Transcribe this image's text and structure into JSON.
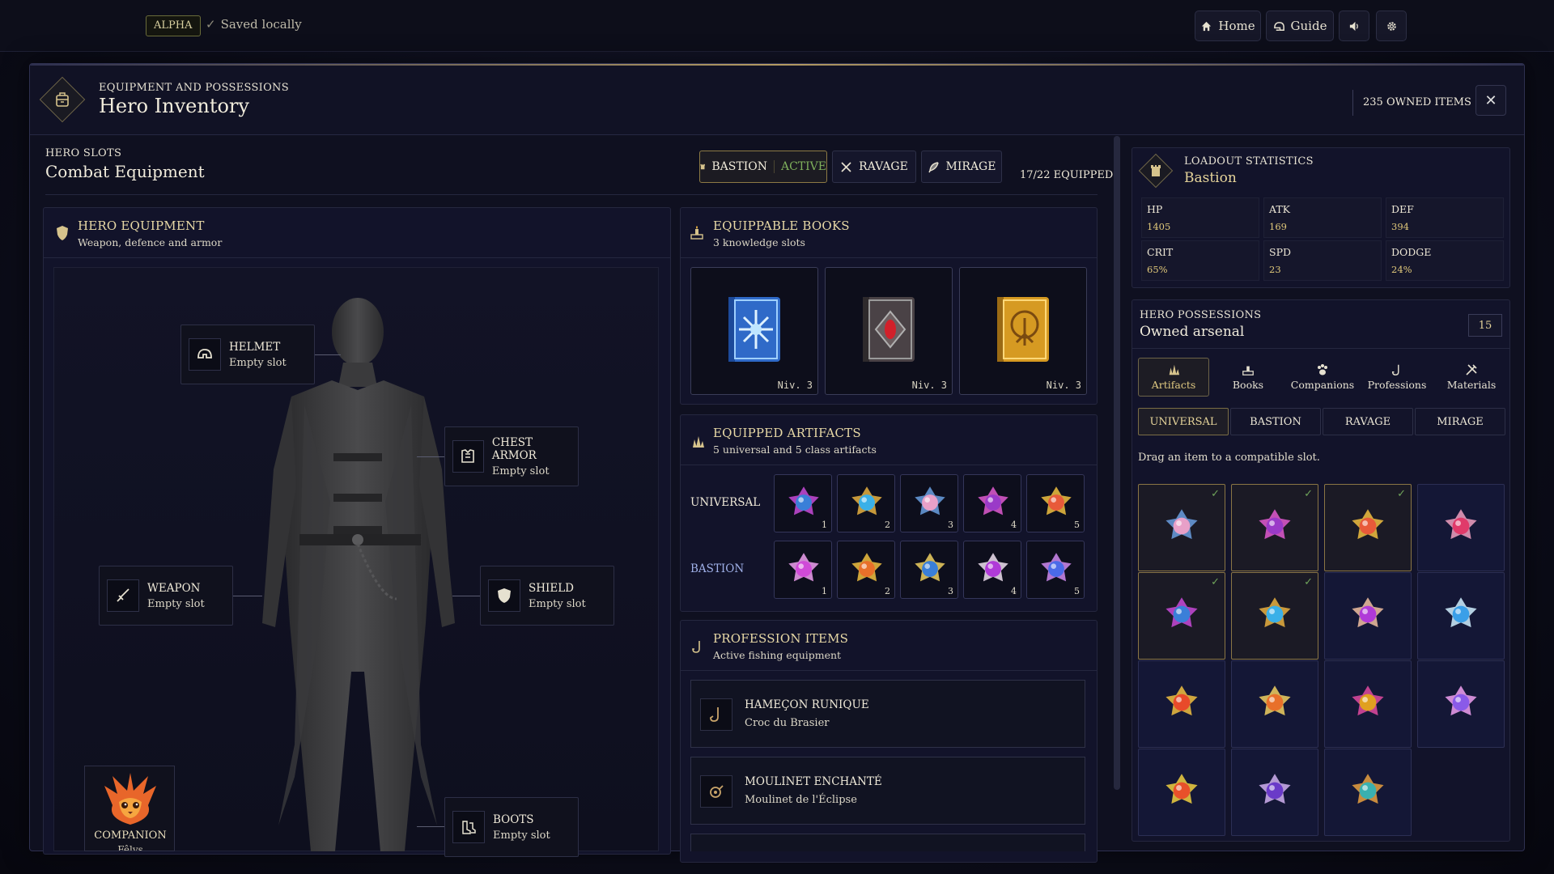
{
  "topbar": {
    "badge": "ALPHA",
    "save_status": "Saved locally",
    "home_label": "Home",
    "guide_label": "Guide"
  },
  "modal": {
    "kicker": "EQUIPMENT AND POSSESSIONS",
    "title": "Hero Inventory",
    "owned_count": "235 OWNED ITEMS"
  },
  "slots_section": {
    "kicker": "HERO SLOTS",
    "title": "Combat Equipment",
    "tabs": [
      {
        "label": "BASTION",
        "status": "ACTIVE"
      },
      {
        "label": "RAVAGE"
      },
      {
        "label": "MIRAGE"
      }
    ],
    "equipped_count": "17/22 EQUIPPED"
  },
  "hero_equipment": {
    "title": "HERO EQUIPMENT",
    "subtitle": "Weapon, defence and armor",
    "slots": {
      "helmet": {
        "name": "HELMET",
        "status": "Empty slot"
      },
      "chest": {
        "name": "CHEST ARMOR",
        "status": "Empty slot"
      },
      "weapon": {
        "name": "WEAPON",
        "status": "Empty slot"
      },
      "shield": {
        "name": "SHIELD",
        "status": "Empty slot"
      },
      "boots": {
        "name": "BOOTS",
        "status": "Empty slot"
      }
    },
    "companion": {
      "label": "COMPANION",
      "name": "Fêlys"
    }
  },
  "books": {
    "title": "EQUIPPABLE BOOKS",
    "subtitle": "3 knowledge slots",
    "items": [
      {
        "level": "Niv. 3",
        "icon": "ice-snowflake-book-icon",
        "color": "#4a8fd8"
      },
      {
        "level": "Niv. 3",
        "icon": "ruby-eye-book-icon",
        "color": "#6b5a52"
      },
      {
        "level": "Niv. 3",
        "icon": "golden-tree-book-icon",
        "color": "#d59a24"
      }
    ]
  },
  "artifacts": {
    "title": "EQUIPPED ARTIFACTS",
    "subtitle": "5 universal and 5 class artifacts",
    "rows": [
      {
        "label": "UNIVERSAL",
        "label_color": "#f0ead9",
        "items": [
          {
            "num": "1",
            "colors": [
              "#3a7fd8",
              "#c84ad8"
            ]
          },
          {
            "num": "2",
            "colors": [
              "#3ab0e8",
              "#e8b040"
            ]
          },
          {
            "num": "3",
            "colors": [
              "#e8a0c8",
              "#6a9fe0"
            ]
          },
          {
            "num": "4",
            "colors": [
              "#9a3ac8",
              "#e05ad0"
            ]
          },
          {
            "num": "5",
            "colors": [
              "#e85a3a",
              "#f0c040"
            ]
          }
        ]
      },
      {
        "label": "BASTION",
        "label_color": "#9fb0e8",
        "items": [
          {
            "num": "1",
            "colors": [
              "#d04ad8",
              "#f0a0f0"
            ]
          },
          {
            "num": "2",
            "colors": [
              "#e8702a",
              "#f0c040"
            ]
          },
          {
            "num": "3",
            "colors": [
              "#3a7fd8",
              "#f0d060"
            ]
          },
          {
            "num": "4",
            "colors": [
              "#b03ad8",
              "#f0e0f0"
            ]
          },
          {
            "num": "5",
            "colors": [
              "#4a6ae8",
              "#d08af0"
            ]
          }
        ]
      }
    ]
  },
  "profession": {
    "title": "PROFESSION ITEMS",
    "subtitle": "Active fishing equipment",
    "items": [
      {
        "name": "HAMEÇON RUNIQUE",
        "sub": "Croc du Brasier",
        "icon": "fishing-hook-icon"
      },
      {
        "name": "MOULINET ENCHANTÉ",
        "sub": "Moulinet de l'Éclipse",
        "icon": "fishing-reel-icon"
      }
    ]
  },
  "loadout": {
    "kicker": "LOADOUT STATISTICS",
    "title": "Bastion",
    "stats": [
      {
        "key": "HP",
        "value": "1405"
      },
      {
        "key": "ATK",
        "value": "169"
      },
      {
        "key": "DEF",
        "value": "394"
      },
      {
        "key": "CRIT",
        "value": "65%"
      },
      {
        "key": "SPD",
        "value": "23"
      },
      {
        "key": "DODGE",
        "value": "24%"
      }
    ]
  },
  "possessions": {
    "kicker": "HERO POSSESSIONS",
    "title": "Owned arsenal",
    "count": "15",
    "tabs": [
      "Artifacts",
      "Books",
      "Companions",
      "Professions",
      "Materials"
    ],
    "filters": [
      "UNIVERSAL",
      "BASTION",
      "RAVAGE",
      "MIRAGE"
    ],
    "hint": "Drag an item to a compatible slot.",
    "grid": [
      {
        "equipped": true,
        "colors": [
          "#e8a0c8",
          "#6a9fe0"
        ]
      },
      {
        "equipped": true,
        "colors": [
          "#9a3ac8",
          "#e05ad0"
        ]
      },
      {
        "equipped": true,
        "colors": [
          "#e85a3a",
          "#f0c040"
        ]
      },
      {
        "equipped": false,
        "colors": [
          "#e03a6a",
          "#f0a0c0"
        ]
      },
      {
        "equipped": true,
        "colors": [
          "#3a7fd8",
          "#c84ad8"
        ]
      },
      {
        "equipped": true,
        "colors": [
          "#3ab0e8",
          "#e8b040"
        ]
      },
      {
        "equipped": false,
        "colors": [
          "#b03ad8",
          "#f0c0a0"
        ]
      },
      {
        "equipped": false,
        "colors": [
          "#3a9fe8",
          "#d0f0ff"
        ]
      },
      {
        "equipped": false,
        "colors": [
          "#e84a2a",
          "#f0c040"
        ]
      },
      {
        "equipped": false,
        "colors": [
          "#e8702a",
          "#f0d060"
        ]
      },
      {
        "equipped": false,
        "colors": [
          "#e0a020",
          "#e04aa0"
        ]
      },
      {
        "equipped": false,
        "colors": [
          "#8a5ae8",
          "#f0a0f0"
        ]
      },
      {
        "equipped": false,
        "colors": [
          "#e8502a",
          "#f0d040"
        ]
      },
      {
        "equipped": false,
        "colors": [
          "#6a3ac8",
          "#d0b0f0"
        ]
      },
      {
        "equipped": false,
        "colors": [
          "#3ab0b0",
          "#e8a040"
        ]
      }
    ]
  },
  "colors": {
    "accent_gold": "#e8d9a6",
    "active_green": "#7fb05c",
    "panel": "#12132a"
  }
}
